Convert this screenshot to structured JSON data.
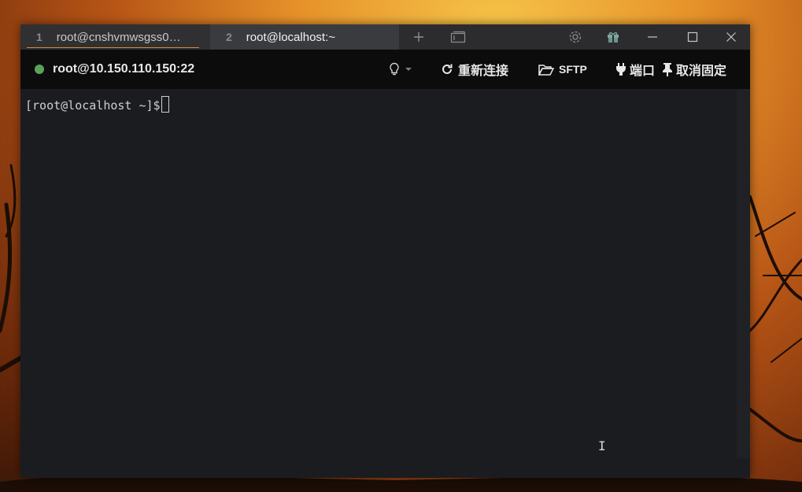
{
  "tabs": [
    {
      "index": "1",
      "title": "root@cnshvmwsgss0…",
      "active": false
    },
    {
      "index": "2",
      "title": "root@localhost:~",
      "active": true
    }
  ],
  "tabbar_icons": {
    "new_tab": "plus-icon",
    "new_window": "window-icon",
    "settings": "gear-icon",
    "gift": "gift-icon",
    "minimize": "minimize-icon",
    "maximize": "maximize-icon",
    "close": "close-icon"
  },
  "toolbar": {
    "host": "root@10.150.110.150:22",
    "status_color": "#5aa25a",
    "hint_icon": "lightbulb-icon",
    "reconnect_label": "重新连接",
    "sftp_label": "SFTP",
    "port_label": "端口",
    "unpin_label": "取消固定"
  },
  "terminal": {
    "prompt": "[root@localhost ~]$"
  },
  "colors": {
    "tab_underline": "#d08a3a",
    "terminal_bg": "#1b1c1f",
    "toolbar_bg": "#0c0c0d"
  }
}
